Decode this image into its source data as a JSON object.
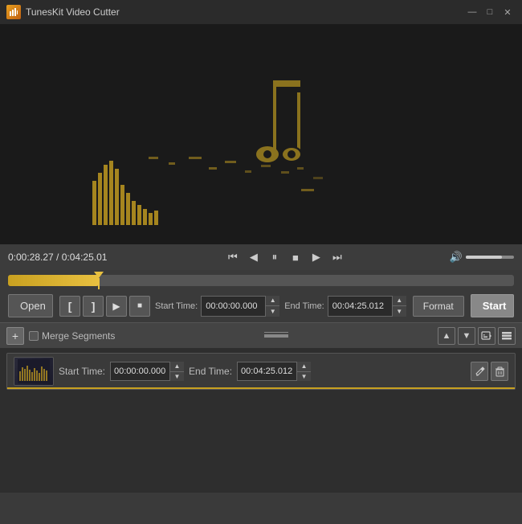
{
  "app": {
    "title": "TunesKit Video Cutter",
    "icon": "🎵"
  },
  "titlebar": {
    "minimize_label": "—",
    "maximize_label": "□",
    "close_label": "✕"
  },
  "video": {
    "bg_color": "#1a1a1a"
  },
  "controls": {
    "time_current": "0:00:28.27",
    "time_total": "0:04:25.01",
    "time_display": "0:00:28.27 / 0:04:25.01",
    "btn_skip_back": "⏮",
    "btn_prev": "◀",
    "btn_pause": "⏸",
    "btn_stop": "■",
    "btn_play": "▶",
    "btn_skip_fwd": "⏭"
  },
  "cut_controls": {
    "open_label": "Open",
    "start_label": "Start",
    "format_label": "Format",
    "start_time_label": "Start Time:",
    "end_time_label": "End Time:",
    "start_time_value": "00:00:00.000",
    "end_time_value": "00:04:25.012",
    "cut_btn1": "[",
    "cut_btn2": "]",
    "cut_play": "▶",
    "cut_stop": "■"
  },
  "segments": {
    "add_label": "+",
    "merge_label": "Merge Segments",
    "up_label": "▲",
    "down_label": "▼",
    "rows": [
      {
        "start_time": "00:00:00.000",
        "end_time": "00:04:25.012"
      }
    ]
  }
}
